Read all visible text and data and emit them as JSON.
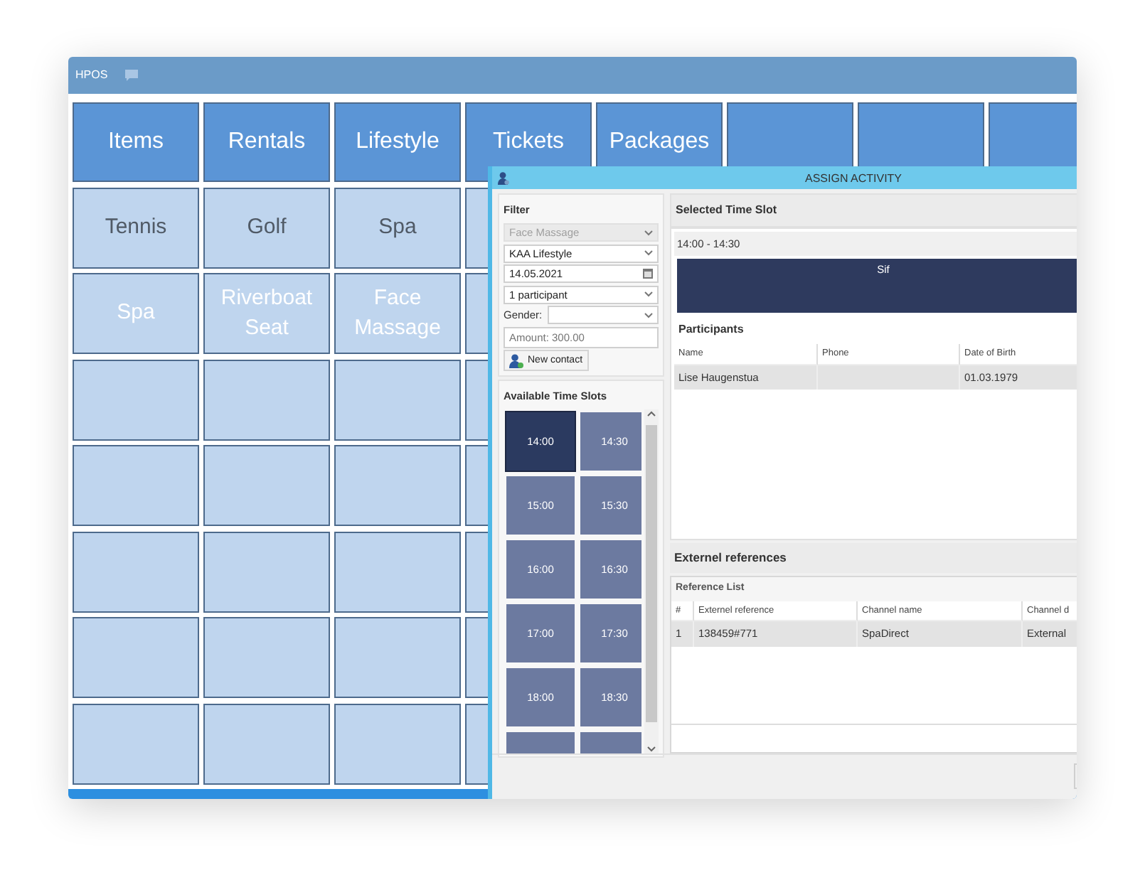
{
  "app": {
    "title": "HPOS"
  },
  "categories": [
    {
      "label": "Items"
    },
    {
      "label": "Rentals"
    },
    {
      "label": "Lifestyle"
    },
    {
      "label": "Tickets"
    },
    {
      "label": "Packages"
    }
  ],
  "tile_rows": [
    [
      {
        "label": "Tennis",
        "kind": "group"
      },
      {
        "label": "Golf",
        "kind": "group"
      },
      {
        "label": "Spa",
        "kind": "group"
      }
    ],
    [
      {
        "label": "Spa",
        "kind": "activity"
      },
      {
        "label": "Riverboat Seat",
        "kind": "activity"
      },
      {
        "label": "Face Massage",
        "kind": "activity"
      }
    ]
  ],
  "dialog": {
    "title": "ASSIGN ACTIVITY",
    "filter": {
      "heading": "Filter",
      "activity": {
        "value": "Face Massage",
        "disabled": true
      },
      "location": "KAA Lifestyle",
      "date": "14.05.2021",
      "participants": "1 participant",
      "gender_label": "Gender:",
      "amount": {
        "placeholder": "Amount: 300.00"
      },
      "new_contact_button": "New contact"
    },
    "time_slots": {
      "heading": "Available Time Slots",
      "slots": [
        {
          "kind": "slot",
          "label": "14:00",
          "selected": true
        },
        {
          "kind": "slot",
          "label": "14:30",
          "selected": false
        },
        {
          "kind": "slot",
          "label": "15:00",
          "selected": false
        },
        {
          "kind": "slot",
          "label": "15:30",
          "selected": false
        },
        {
          "kind": "slot",
          "label": "16:00",
          "selected": false
        },
        {
          "kind": "slot",
          "label": "16:30",
          "selected": false
        },
        {
          "kind": "slot",
          "label": "17:00",
          "selected": false
        },
        {
          "kind": "slot",
          "label": "17:30",
          "selected": false
        },
        {
          "kind": "slot",
          "label": "18:00",
          "selected": false
        },
        {
          "kind": "slot",
          "label": "18:30",
          "selected": false
        },
        {
          "kind": "partial",
          "selected": false
        },
        {
          "kind": "partial",
          "selected": false
        }
      ]
    },
    "selected_time_slot": {
      "heading": "Selected Time Slot",
      "range": "14:00 - 14:30",
      "resource": "Sif"
    },
    "participants": {
      "heading": "Participants",
      "columns": [
        "Name",
        "Phone",
        "Date of Birth"
      ],
      "rows": [
        {
          "name": "Lise Haugenstua",
          "date_of_birth": "01.03.1979"
        }
      ]
    },
    "external_references": {
      "heading": "Externel references",
      "list_heading": "Reference List",
      "columns": [
        "#",
        "Externel reference",
        "Channel name",
        "Channel d"
      ],
      "rows": [
        [
          "1",
          "138459#771",
          "SpaDirect",
          "External"
        ]
      ]
    }
  }
}
